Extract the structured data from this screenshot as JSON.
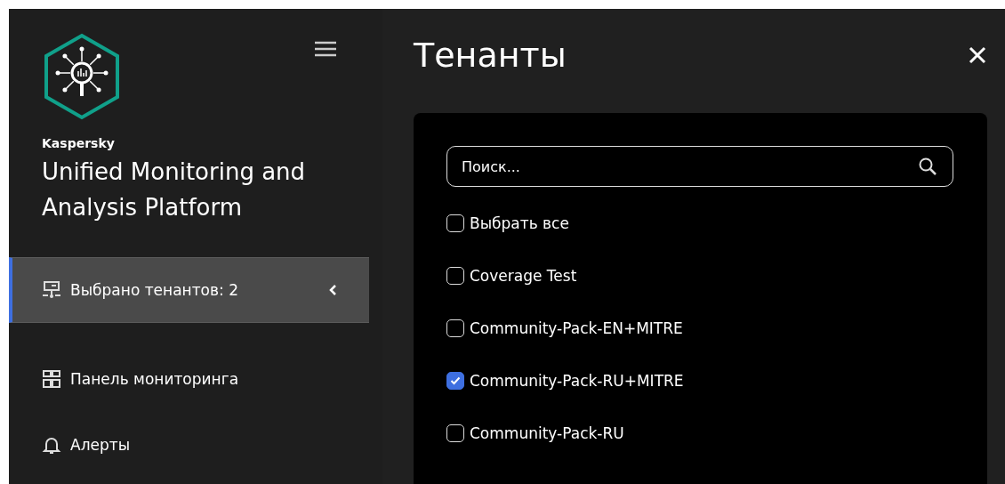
{
  "sidebar": {
    "brand": "Kaspersky",
    "product": "Unified Monitoring and Analysis Platform",
    "items": [
      {
        "label": "Выбрано тенантов: 2",
        "kind": "tenants",
        "selected": true
      },
      {
        "label": "Панель мониторинга",
        "kind": "dashboard",
        "selected": false
      },
      {
        "label": "Алерты",
        "kind": "alerts",
        "selected": false
      }
    ]
  },
  "panel": {
    "title": "Тенанты",
    "search": {
      "placeholder": "Поиск..."
    },
    "options": [
      {
        "label": "Выбрать все",
        "checked": false
      },
      {
        "label": "Coverage Test",
        "checked": false
      },
      {
        "label": "Community-Pack-EN+MITRE",
        "checked": false
      },
      {
        "label": "Community-Pack-RU+MITRE",
        "checked": true
      },
      {
        "label": "Community-Pack-RU",
        "checked": false
      }
    ]
  }
}
